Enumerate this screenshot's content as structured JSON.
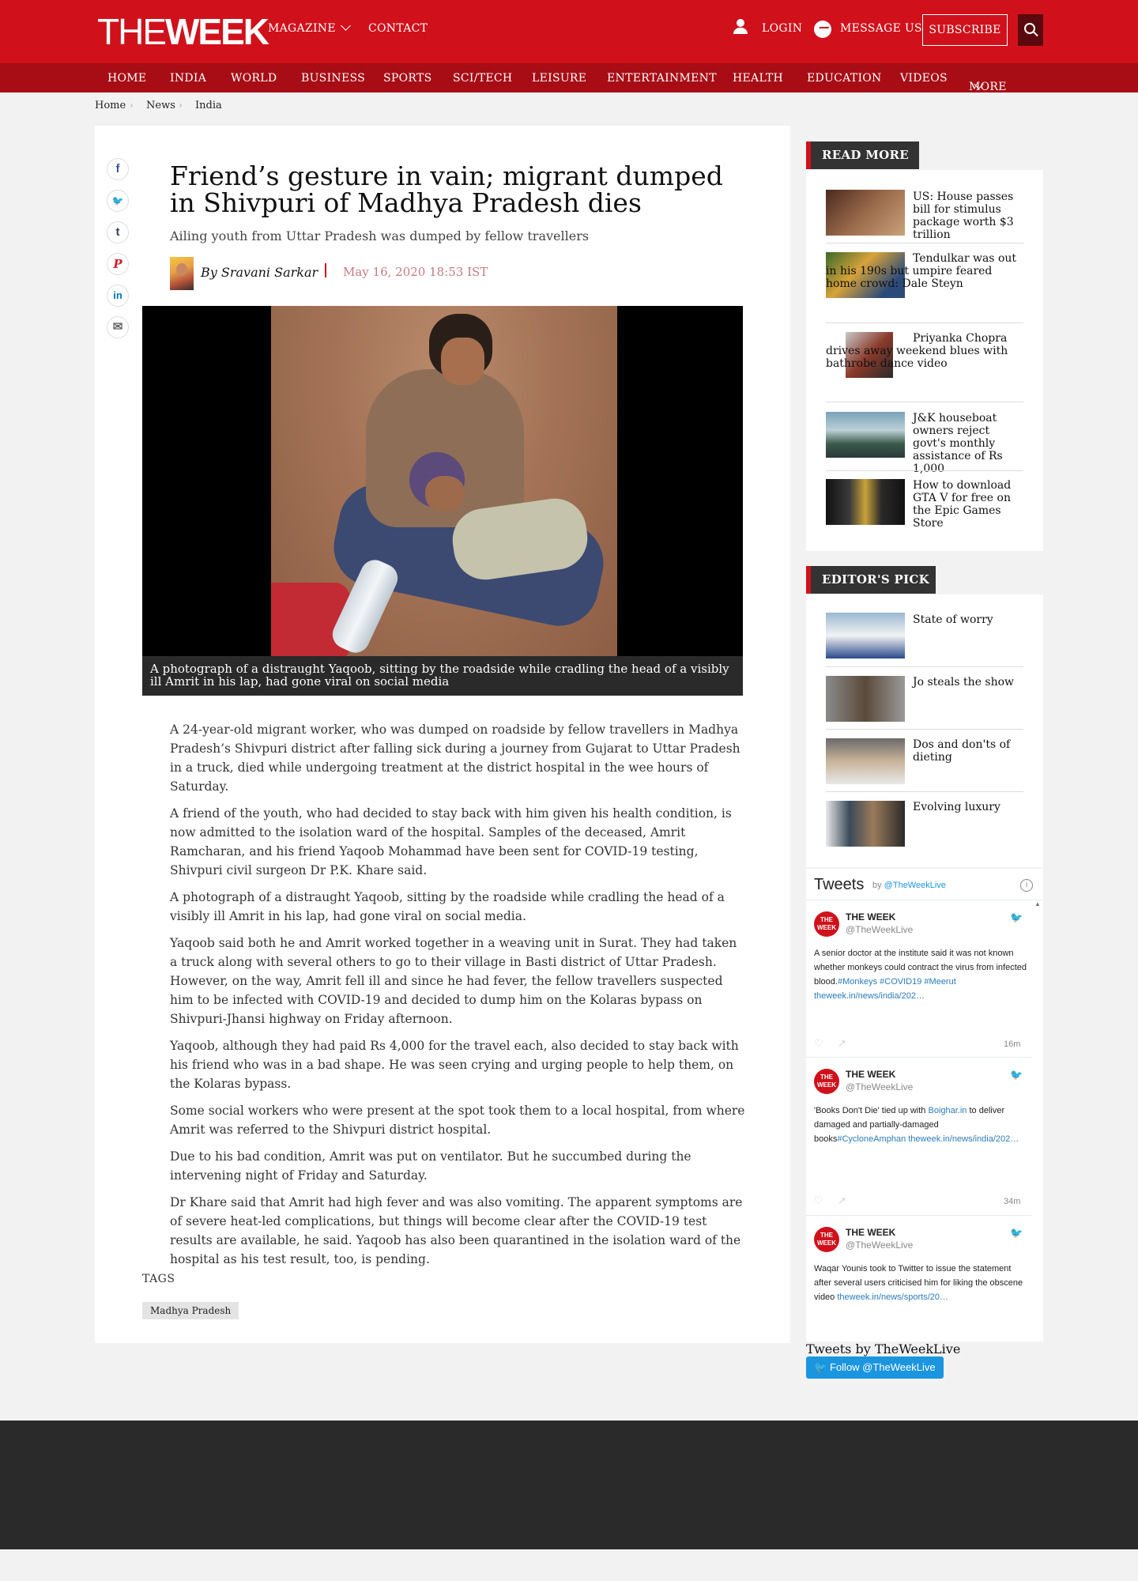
{
  "header": {
    "logo_the": "THE",
    "logo_week": "WEEK",
    "nav": {
      "magazine": "MAGAZINE",
      "contact": "CONTACT"
    },
    "login": "LOGIN",
    "message_us": "MESSAGE US",
    "subscribe": "SUBSCRIBE",
    "brand_color": "#d0111b"
  },
  "sections": [
    "HOME",
    "INDIA",
    "WORLD",
    "BUSINESS",
    "SPORTS",
    "SCI/TECH",
    "LEISURE",
    "ENTERTAINMENT",
    "HEALTH",
    "EDUCATION",
    "VIDEOS",
    "MORE"
  ],
  "breadcrumb": [
    "Home",
    "News",
    "India"
  ],
  "share_icons": [
    "facebook-icon",
    "twitter-icon",
    "tumblr-icon",
    "pinterest-icon",
    "linkedin-icon",
    "email-icon"
  ],
  "share_glyphs": [
    "f",
    "🐦",
    "t",
    "P",
    "in",
    "✉"
  ],
  "article": {
    "headline": "Friend’s gesture in vain; migrant dumped in Shivpuri of Madhya Pradesh dies",
    "subhead": "Ailing youth from Uttar Pradesh was dumped by fellow travellers",
    "author": "By Sravani Sarkar",
    "date": "May 16, 2020 18:53 IST",
    "caption": "A photograph of a distraught Yaqoob, sitting by the roadside while cradling the head of a visibly ill Amrit in his lap, had gone viral on social media",
    "paragraphs": [
      "A 24-year-old migrant worker, who was dumped on roadside by fellow travellers in Madhya Pradesh’s Shivpuri district after falling sick during a journey from Gujarat to Uttar Pradesh in a truck, died while undergoing treatment at the district hospital in the wee hours of Saturday.",
      "A friend of the youth, who had decided to stay back with him given his health condition, is now admitted to the isolation ward of the hospital. Samples of the deceased, Amrit Ramcharan, and his friend Yaqoob Mohammad have been sent for COVID-19 testing, Shivpuri civil surgeon Dr P.K. Khare said.",
      "A photograph of a distraught Yaqoob, sitting by the roadside while cradling the head of a visibly ill Amrit in his lap, had gone viral on social media.",
      "Yaqoob said both he and Amrit worked together in a weaving unit in Surat. They had taken a truck along with several others to go to their village in Basti district of Uttar Pradesh. However, on the way, Amrit fell ill and since he had fever, the fellow travellers suspected him to be infected with COVID-19 and decided to dump him on the Kolaras bypass on Shivpuri-Jhansi highway on Friday afternoon.",
      "Yaqoob, although they had paid Rs 4,000 for the travel each, also decided to stay back with his friend who was in a bad shape. He was seen crying and urging people to help them, on the Kolaras bypass.",
      "Some social workers who were present at the spot took them to a local hospital, from where Amrit was referred to the Shivpuri district hospital.",
      "Due to his bad condition, Amrit was put on ventilator. But he succumbed during the intervening night of Friday and Saturday.",
      "Dr Khare said that Amrit had high fever and was also vomiting. The apparent symptoms are of severe heat-led complications, but things will become clear after the COVID-19 test results are available, he said. Yaqoob has also been quarantined in the isolation ward of the hospital as his test result, too, is pending."
    ],
    "tags_label": "TAGS",
    "tags": [
      "Madhya Pradesh"
    ]
  },
  "read_more": {
    "heading": "READ MORE",
    "items": [
      "US: House passes bill for stimulus package worth $3 trillion",
      "Tendulkar was out in his 190s but umpire feared home crowd: Dale Steyn",
      "Priyanka Chopra drives away weekend blues with bathrobe dance video",
      "J&K houseboat owners reject govt's monthly assistance of Rs 1,000",
      "How to download GTA V for free on the Epic Games Store"
    ]
  },
  "editors_pick": {
    "heading": "EDITOR'S PICK",
    "items": [
      "State of worry",
      "Jo steals the show",
      "Dos and don'ts of dieting",
      "Evolving luxury"
    ]
  },
  "twitter": {
    "title": "Tweets",
    "by": "by",
    "by_handle": "@TheWeekLive",
    "tweets": [
      {
        "name": "THE WEEK",
        "handle": "@TheWeekLive",
        "text": "A senior doctor at the institute said it was not known whether monkeys could contract the virus from infected blood.",
        "links": "#Monkeys #COVID19 #Meerut theweek.in/news/india/202…",
        "time": "16m"
      },
      {
        "name": "THE WEEK",
        "handle": "@TheWeekLive",
        "text_a": "'Books Don't Die' tied up with ",
        "link_a": "Boighar.in",
        "text_b": " to deliver damaged and partially-damaged books",
        "link_b": "#CycloneAmphan theweek.in/news/india/202…",
        "time": "34m"
      },
      {
        "name": "THE WEEK",
        "handle": "@TheWeekLive",
        "text": "Waqar Younis took to Twitter to issue the statement after several users criticised him for liking the obscene video",
        "links": "theweek.in/news/sports/20…"
      }
    ],
    "footer": "Tweets by TheWeekLive",
    "follow": "Follow @TheWeekLive"
  }
}
